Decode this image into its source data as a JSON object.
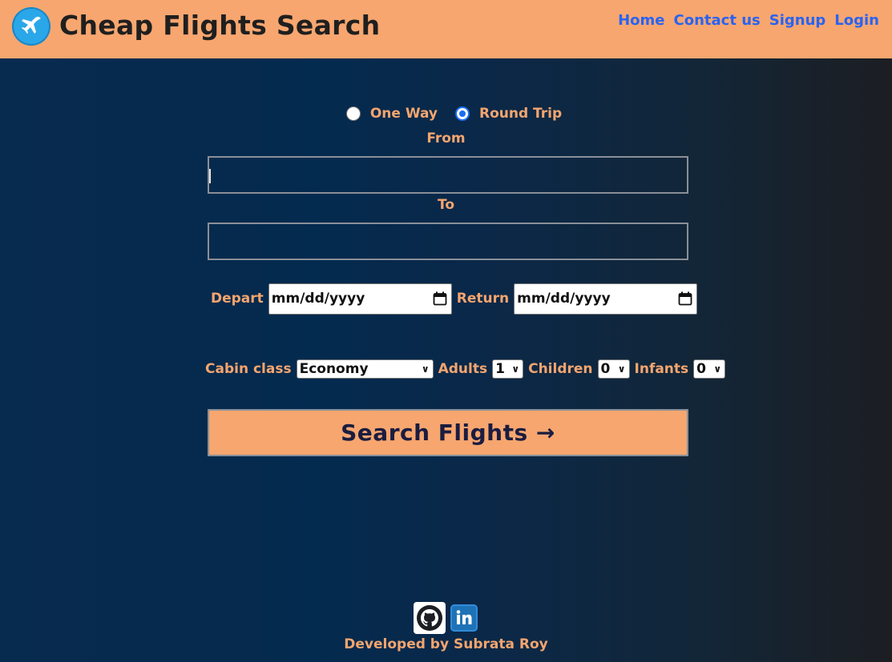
{
  "header": {
    "title": "Cheap Flights Search",
    "logo_icon": "airplane-icon",
    "nav": [
      "Home",
      "Contact us",
      "Signup",
      "Login"
    ]
  },
  "trip_type": {
    "options": [
      "One Way",
      "Round Trip"
    ],
    "selected": "Round Trip"
  },
  "form": {
    "from_label": "From",
    "from_value": "",
    "to_label": "To",
    "to_value": "",
    "depart_label": "Depart",
    "depart_placeholder": "mm/dd/yyyy",
    "return_label": "Return",
    "return_placeholder": "mm/dd/yyyy",
    "cabin_label": "Cabin class",
    "cabin_value": "Economy",
    "adults_label": "Adults",
    "adults_value": "1",
    "children_label": "Children",
    "children_value": "0",
    "infants_label": "Infants",
    "infants_value": "0",
    "search_label": "Search Flights →"
  },
  "footer": {
    "icons": [
      "github-icon",
      "linkedin-icon"
    ],
    "credit": "Developed by Subrata Roy"
  },
  "colors": {
    "header_bg": "#f7a66f",
    "accent_text": "#f4a56f",
    "nav_link": "#2a63f1",
    "button_text": "#1a1d40"
  }
}
